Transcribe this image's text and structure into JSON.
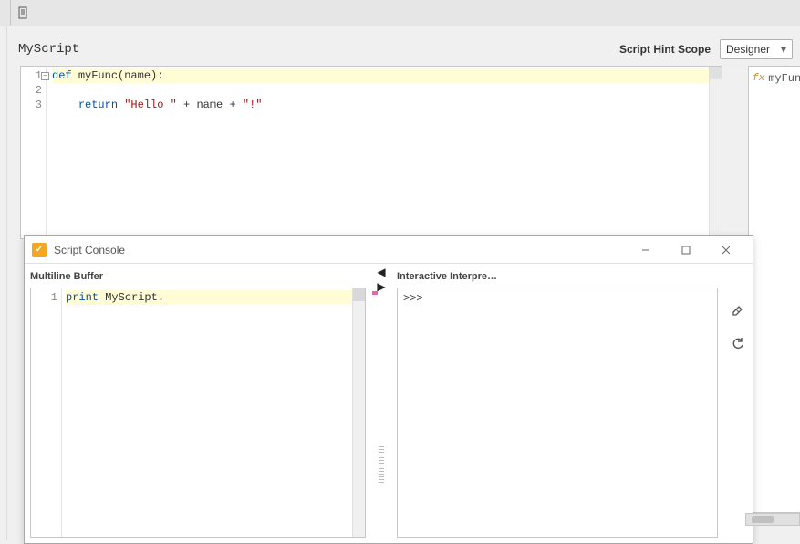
{
  "toolbar": {},
  "header": {
    "title": "MyScript",
    "hint_scope_label": "Script Hint Scope",
    "scope_value": "Designer"
  },
  "editor": {
    "lines": [
      "1",
      "2",
      "3"
    ],
    "line1": {
      "kw": "def ",
      "fn": "myFunc",
      "rest": "(name):"
    },
    "line3": {
      "indent": "    ",
      "kw": "return ",
      "str1": "\"Hello \"",
      "op1": " + ",
      "id": "name",
      "op2": " + ",
      "str2": "\"!\""
    }
  },
  "members": {
    "item1": "myFun"
  },
  "console": {
    "title": "Script Console",
    "buffer_label": "Multiline Buffer",
    "interpreter_label": "Interactive Interpre…",
    "buffer_lines": [
      "1"
    ],
    "buffer_code": {
      "kw": "print ",
      "rest": "MyScript."
    },
    "prompt": ">>> "
  }
}
